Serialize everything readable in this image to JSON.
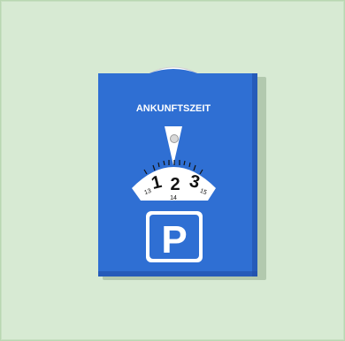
{
  "parking_disc": {
    "heading": "ANKUNFTSZEIT",
    "dial": {
      "big_numbers": [
        "1",
        "2",
        "3"
      ],
      "small_numbers": [
        "13",
        "14",
        "15"
      ]
    },
    "parking_sign_letter": "P"
  },
  "colors": {
    "background": "#d7ead3",
    "disc_blue": "#2f6fd3",
    "disc_blue_dark": "#1f4fa8",
    "white": "#ffffff",
    "text_dark": "#111111"
  }
}
